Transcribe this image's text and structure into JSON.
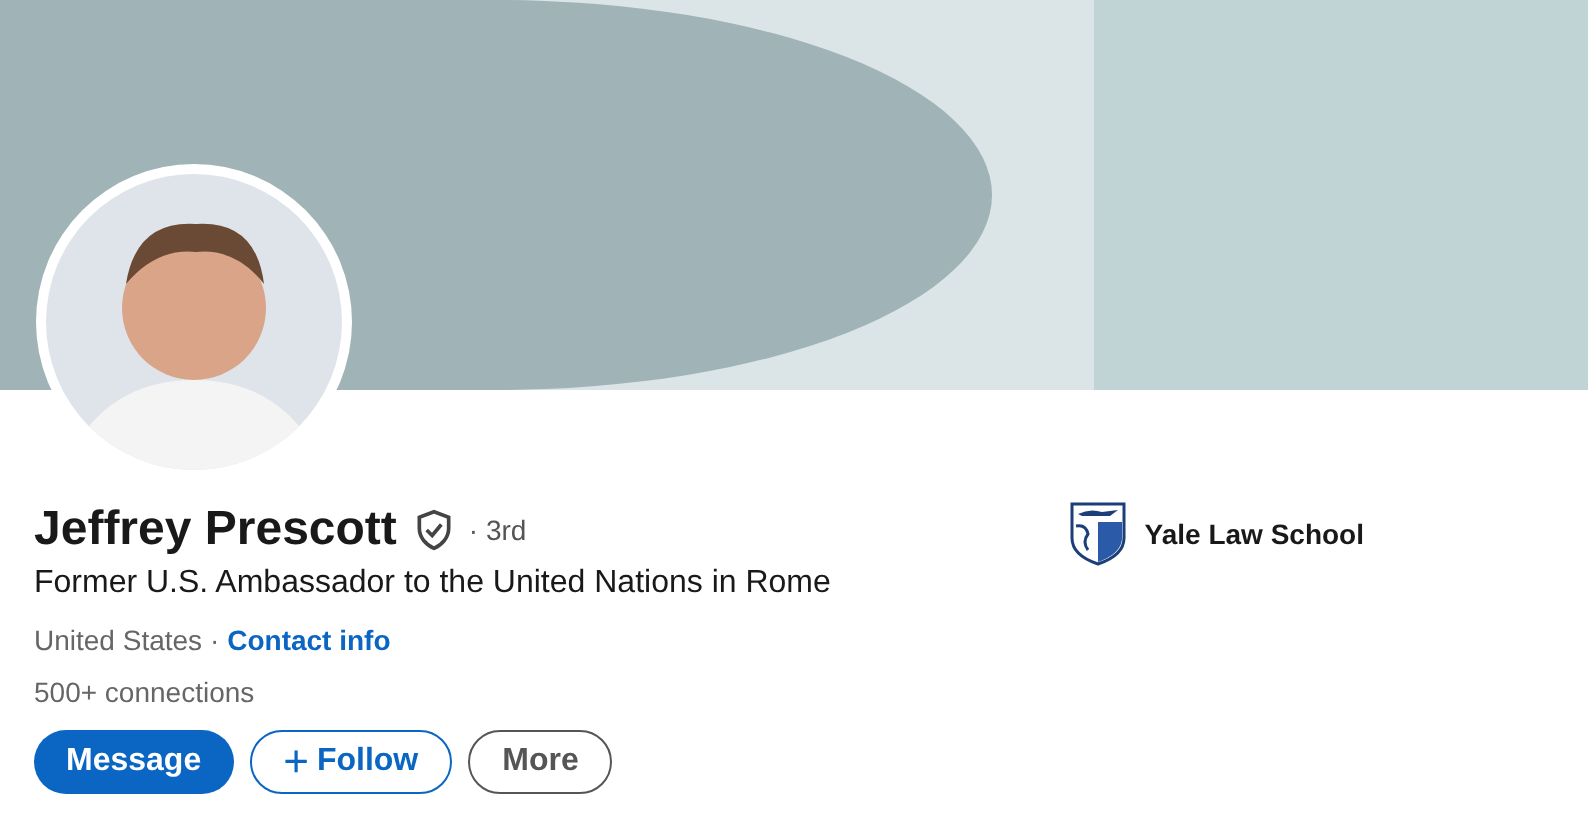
{
  "profile": {
    "name": "Jeffrey Prescott",
    "verified": true,
    "degree": "· 3rd",
    "headline": "Former U.S. Ambassador to the United Nations in Rome",
    "location": "United States ·",
    "contact_link": "Contact info",
    "connections": "500+ connections"
  },
  "education": {
    "school": "Yale Law School"
  },
  "buttons": [
    {
      "kind": "primary",
      "label": "Message"
    },
    {
      "kind": "outline",
      "icon": "+",
      "label": "Follow"
    },
    {
      "kind": "secondary",
      "label": "More"
    }
  ]
}
